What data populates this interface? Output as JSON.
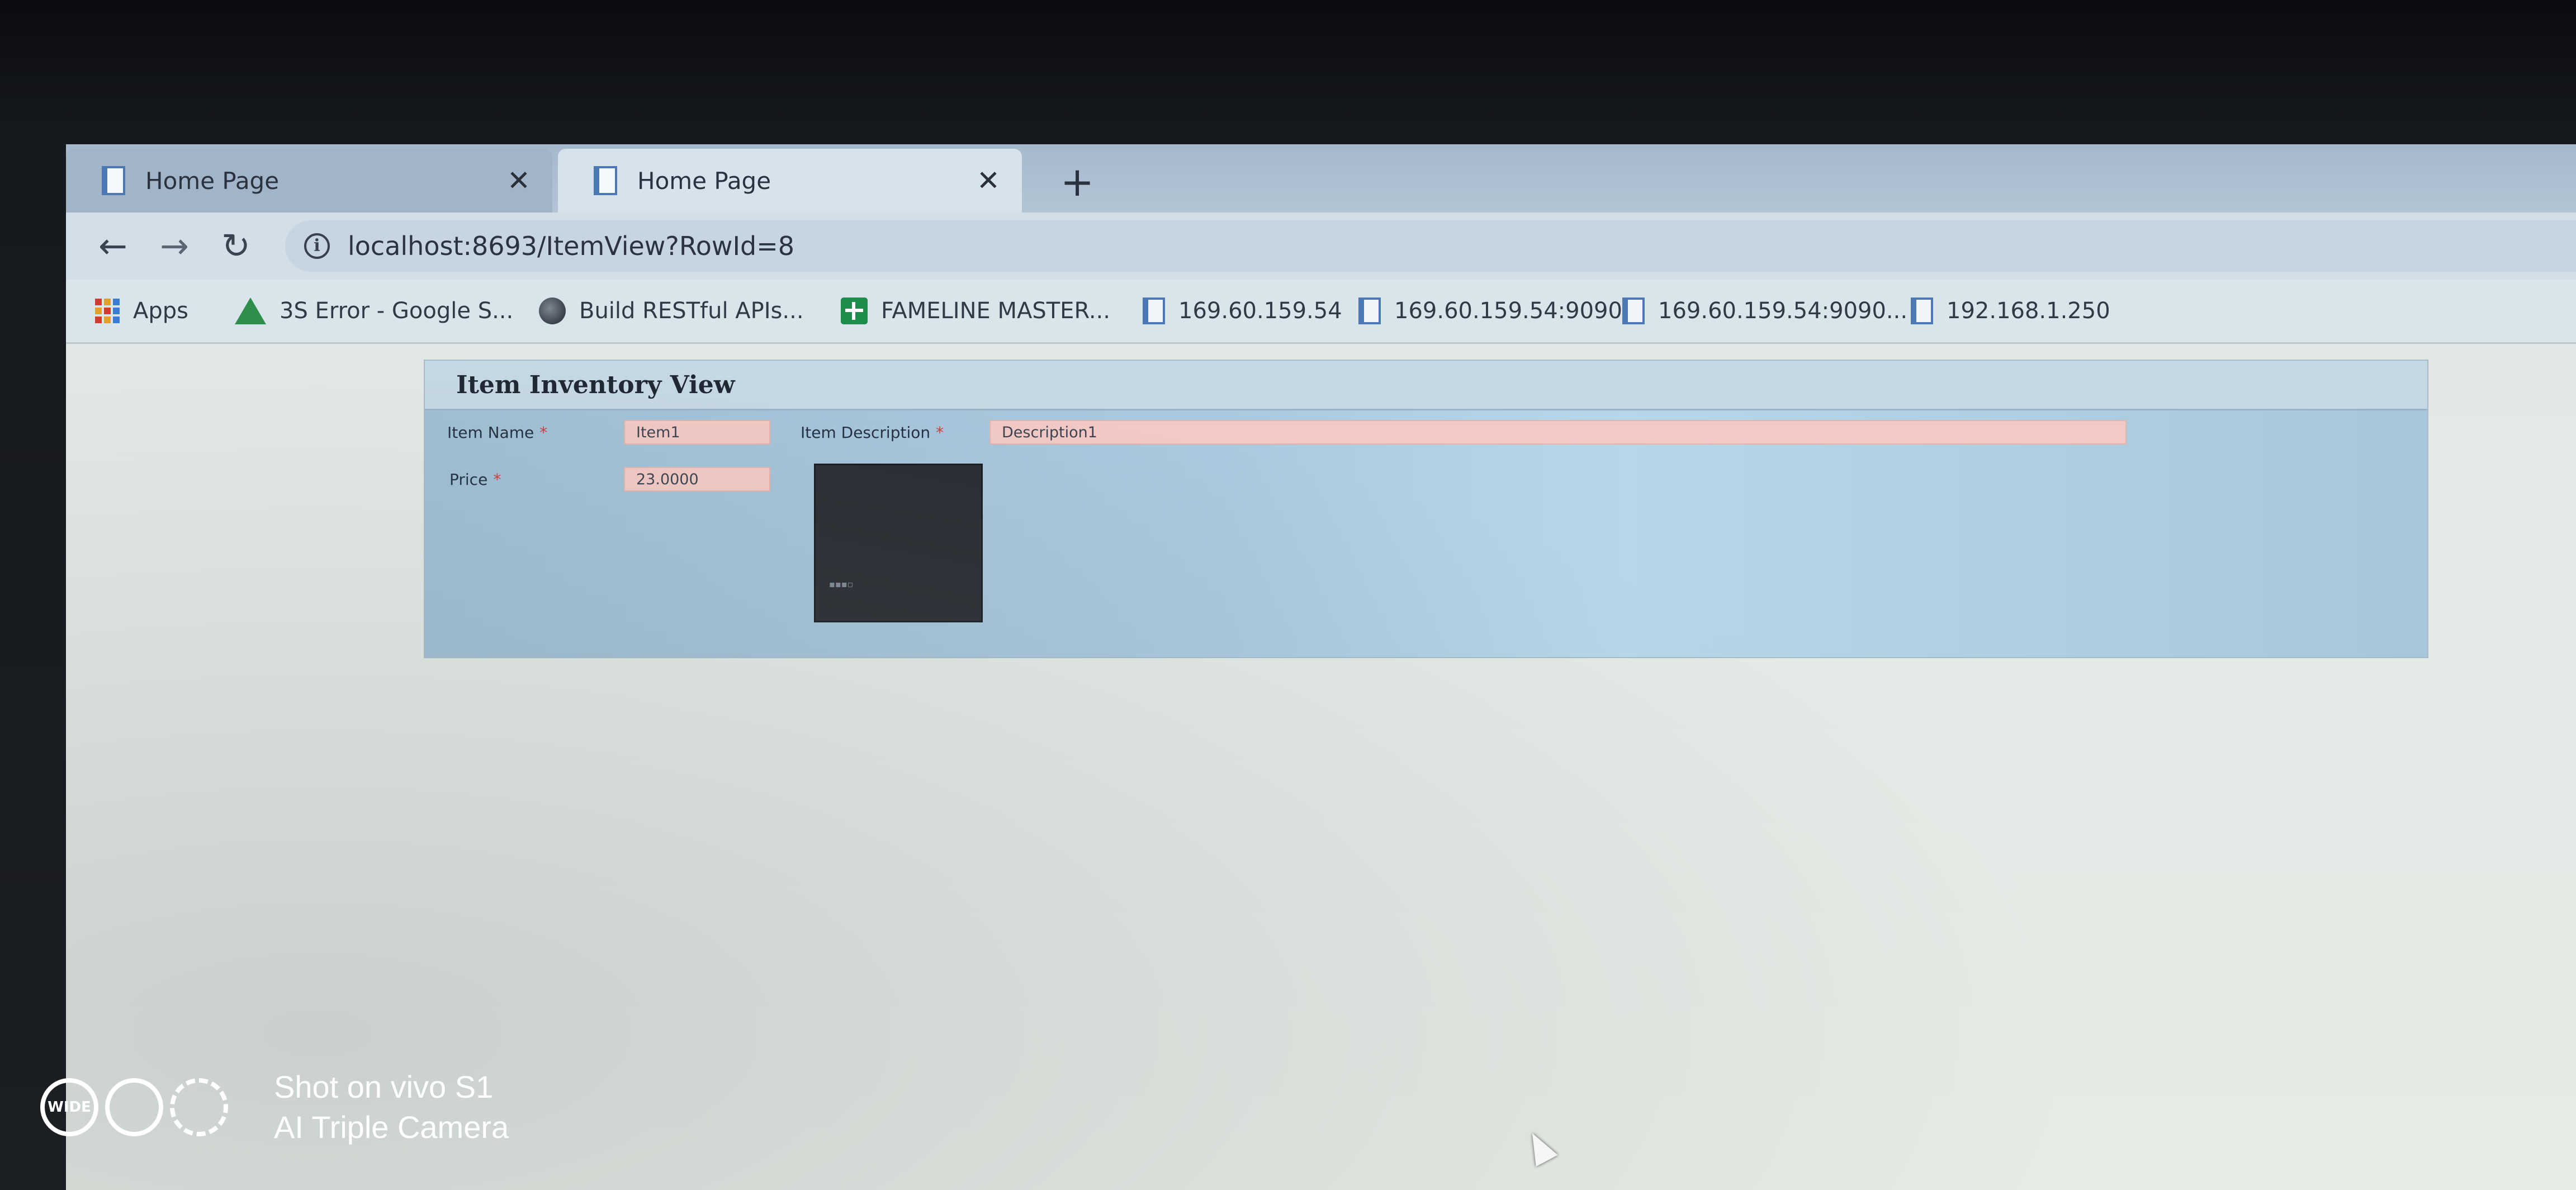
{
  "browser": {
    "tabs": [
      {
        "label": "Home Page",
        "active": false
      },
      {
        "label": "Home Page",
        "active": true
      }
    ],
    "new_tab_label": "+",
    "url": "localhost:8693/ItemView?RowId=8",
    "bookmarks": [
      {
        "label": "Apps",
        "icon": "apps-grid-icon"
      },
      {
        "label": "3S Error - Google S...",
        "icon": "google-drive-icon"
      },
      {
        "label": "Build RESTful APIs...",
        "icon": "globe-icon"
      },
      {
        "label": "FAMELINE MASTER...",
        "icon": "google-sheets-icon"
      },
      {
        "label": "169.60.159.54",
        "icon": "page-icon"
      },
      {
        "label": "169.60.159.54:9090",
        "icon": "page-icon"
      },
      {
        "label": "169.60.159.54:9090...",
        "icon": "page-icon"
      },
      {
        "label": "192.168.1.250",
        "icon": "page-icon"
      }
    ]
  },
  "page": {
    "title": "Item Inventory View",
    "fields": {
      "item_name": {
        "label": "Item Name",
        "required_mark": "*",
        "value": "Item1"
      },
      "item_description": {
        "label": "Item Description",
        "required_mark": "*",
        "value": "Description1"
      },
      "price": {
        "label": "Price",
        "required_mark": "*",
        "value": "23.0000"
      }
    }
  },
  "watermark": {
    "badge": "WIDE",
    "line1": "Shot on vivo S1",
    "line2": "AI Triple Camera"
  },
  "colors": {
    "panel": "#a8c8dc",
    "input_required": "#f2c9c4",
    "tab_active": "#d6e2ec"
  }
}
